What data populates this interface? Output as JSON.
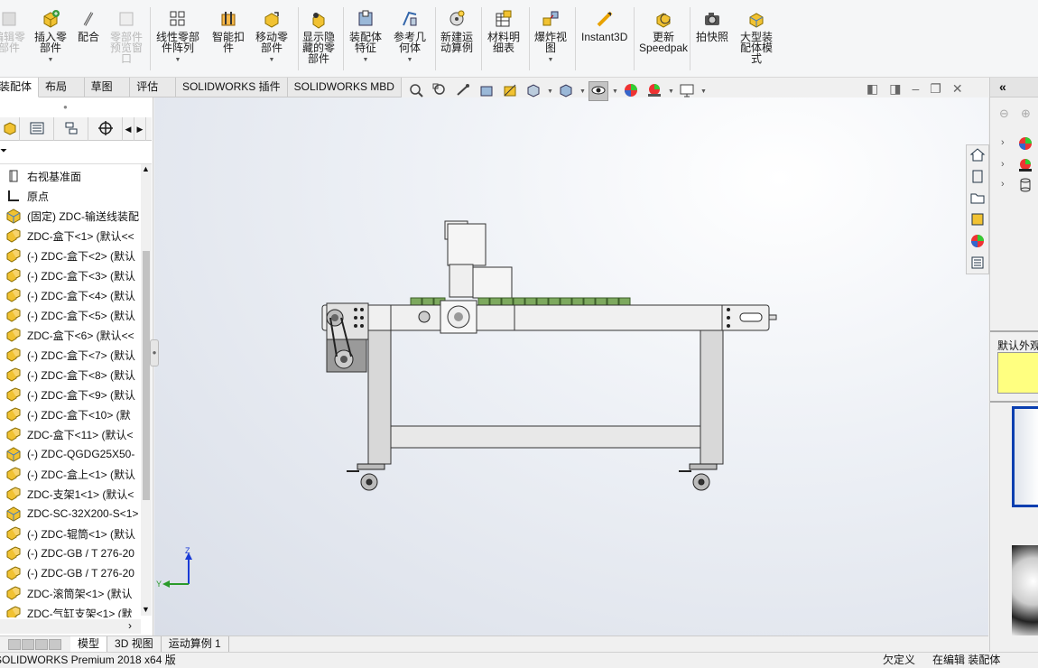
{
  "ribbon": {
    "buttons": [
      {
        "label": "编辑零\n部件",
        "icon": "edit-component-icon",
        "disabled": true
      },
      {
        "label": "插入零\n部件",
        "icon": "insert-component-icon",
        "disabled": false
      },
      {
        "label": "配合",
        "icon": "mate-icon",
        "disabled": false
      },
      {
        "label": "零部件\n预览窗\n口",
        "icon": "component-preview-icon",
        "disabled": true
      },
      {
        "label": "线性零部\n件阵列",
        "icon": "linear-pattern-icon",
        "disabled": false
      },
      {
        "label": "智能扣\n件",
        "icon": "smart-fasteners-icon",
        "disabled": false
      },
      {
        "label": "移动零\n部件",
        "icon": "move-component-icon",
        "disabled": false
      },
      {
        "label": "显示隐\n藏的零\n部件",
        "icon": "show-hidden-icon",
        "disabled": false
      },
      {
        "label": "装配体\n特征",
        "icon": "assembly-features-icon",
        "disabled": false
      },
      {
        "label": "参考几\n何体",
        "icon": "reference-geometry-icon",
        "disabled": false
      },
      {
        "label": "新建运\n动算例",
        "icon": "new-motion-study-icon",
        "disabled": false
      },
      {
        "label": "材料明\n细表",
        "icon": "bom-icon",
        "disabled": false
      },
      {
        "label": "爆炸视\n图",
        "icon": "exploded-view-icon",
        "disabled": false
      },
      {
        "label": "Instant3D",
        "icon": "instant3d-icon",
        "disabled": false
      },
      {
        "label": "更新\nSpeedpak",
        "icon": "update-speedpak-icon",
        "disabled": false
      },
      {
        "label": "拍快照",
        "icon": "snapshot-icon",
        "disabled": false
      },
      {
        "label": "大型装\n配体模\n式",
        "icon": "large-assembly-mode-icon",
        "disabled": false
      }
    ]
  },
  "command_tabs": [
    "装配体",
    "布局",
    "草图",
    "评估",
    "SOLIDWORKS 插件",
    "SOLIDWORKS MBD"
  ],
  "tree": {
    "items": [
      {
        "label": "右视基准面",
        "icon": "plane-icon"
      },
      {
        "label": "原点",
        "icon": "origin-icon"
      },
      {
        "label": "(固定) ZDC-输送线装配",
        "icon": "subassembly-icon"
      },
      {
        "label": "ZDC-盒下<1> (默认<<",
        "icon": "part-icon"
      },
      {
        "label": "(-) ZDC-盒下<2> (默认",
        "icon": "part-icon"
      },
      {
        "label": "(-) ZDC-盒下<3> (默认",
        "icon": "part-icon"
      },
      {
        "label": "(-) ZDC-盒下<4> (默认",
        "icon": "part-icon"
      },
      {
        "label": "(-) ZDC-盒下<5> (默认",
        "icon": "part-icon"
      },
      {
        "label": "ZDC-盒下<6> (默认<<",
        "icon": "part-icon"
      },
      {
        "label": "(-) ZDC-盒下<7> (默认",
        "icon": "part-icon"
      },
      {
        "label": "(-) ZDC-盒下<8> (默认",
        "icon": "part-icon"
      },
      {
        "label": "(-) ZDC-盒下<9> (默认",
        "icon": "part-icon"
      },
      {
        "label": "(-) ZDC-盒下<10> (默",
        "icon": "part-icon"
      },
      {
        "label": "ZDC-盒下<11> (默认<",
        "icon": "part-icon"
      },
      {
        "label": "(-) ZDC-QGDG25X50-",
        "icon": "subassembly-icon"
      },
      {
        "label": "(-) ZDC-盒上<1> (默认",
        "icon": "part-icon"
      },
      {
        "label": "ZDC-支架1<1> (默认<",
        "icon": "part-icon"
      },
      {
        "label": "ZDC-SC-32X200-S<1>",
        "icon": "subassembly-icon"
      },
      {
        "label": "(-) ZDC-辊筒<1> (默认",
        "icon": "part-icon"
      },
      {
        "label": "(-) ZDC-GB / T 276-20",
        "icon": "part-icon"
      },
      {
        "label": "(-) ZDC-GB / T 276-20",
        "icon": "part-icon"
      },
      {
        "label": "ZDC-滚筒架<1> (默认",
        "icon": "part-icon"
      },
      {
        "label": "ZDC-气缸支架<1> (默",
        "icon": "part-icon"
      }
    ]
  },
  "bottom_tabs": [
    "模型",
    "3D 视图",
    "运动算例 1"
  ],
  "status": {
    "app": "SOLIDWORKS Premium 2018 x64 版",
    "definition": "欠定义",
    "mode": "在编辑 装配体"
  },
  "triad": {
    "z_label": "Z",
    "y_label": "Y"
  },
  "taskpane": {
    "appearance_label": "默认外观"
  },
  "colors": {
    "accent": "#0a3fb0",
    "appearance_swatch": "#ffff80",
    "belt_green": "#7da95e"
  }
}
